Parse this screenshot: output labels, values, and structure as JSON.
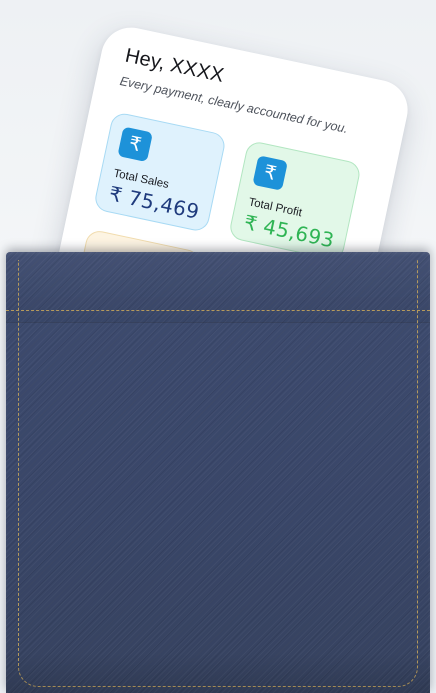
{
  "card": {
    "greeting": "Hey, XXXX",
    "tagline": "Every payment, clearly accounted for you.",
    "tiles": [
      {
        "icon": "rupee-icon",
        "icon_glyph": "₹",
        "label": "Total Sales",
        "value": "₹ 75,469",
        "accent_color": "#1f3b7d"
      },
      {
        "icon": "rupee-icon",
        "icon_glyph": "₹",
        "label": "Total Profit",
        "value": "₹ 45,693",
        "accent_color": "#2fb454"
      }
    ]
  },
  "colors": {
    "denim": "#3c4a6d",
    "stitch": "#b69a5c",
    "badge": "#1d92d9"
  }
}
